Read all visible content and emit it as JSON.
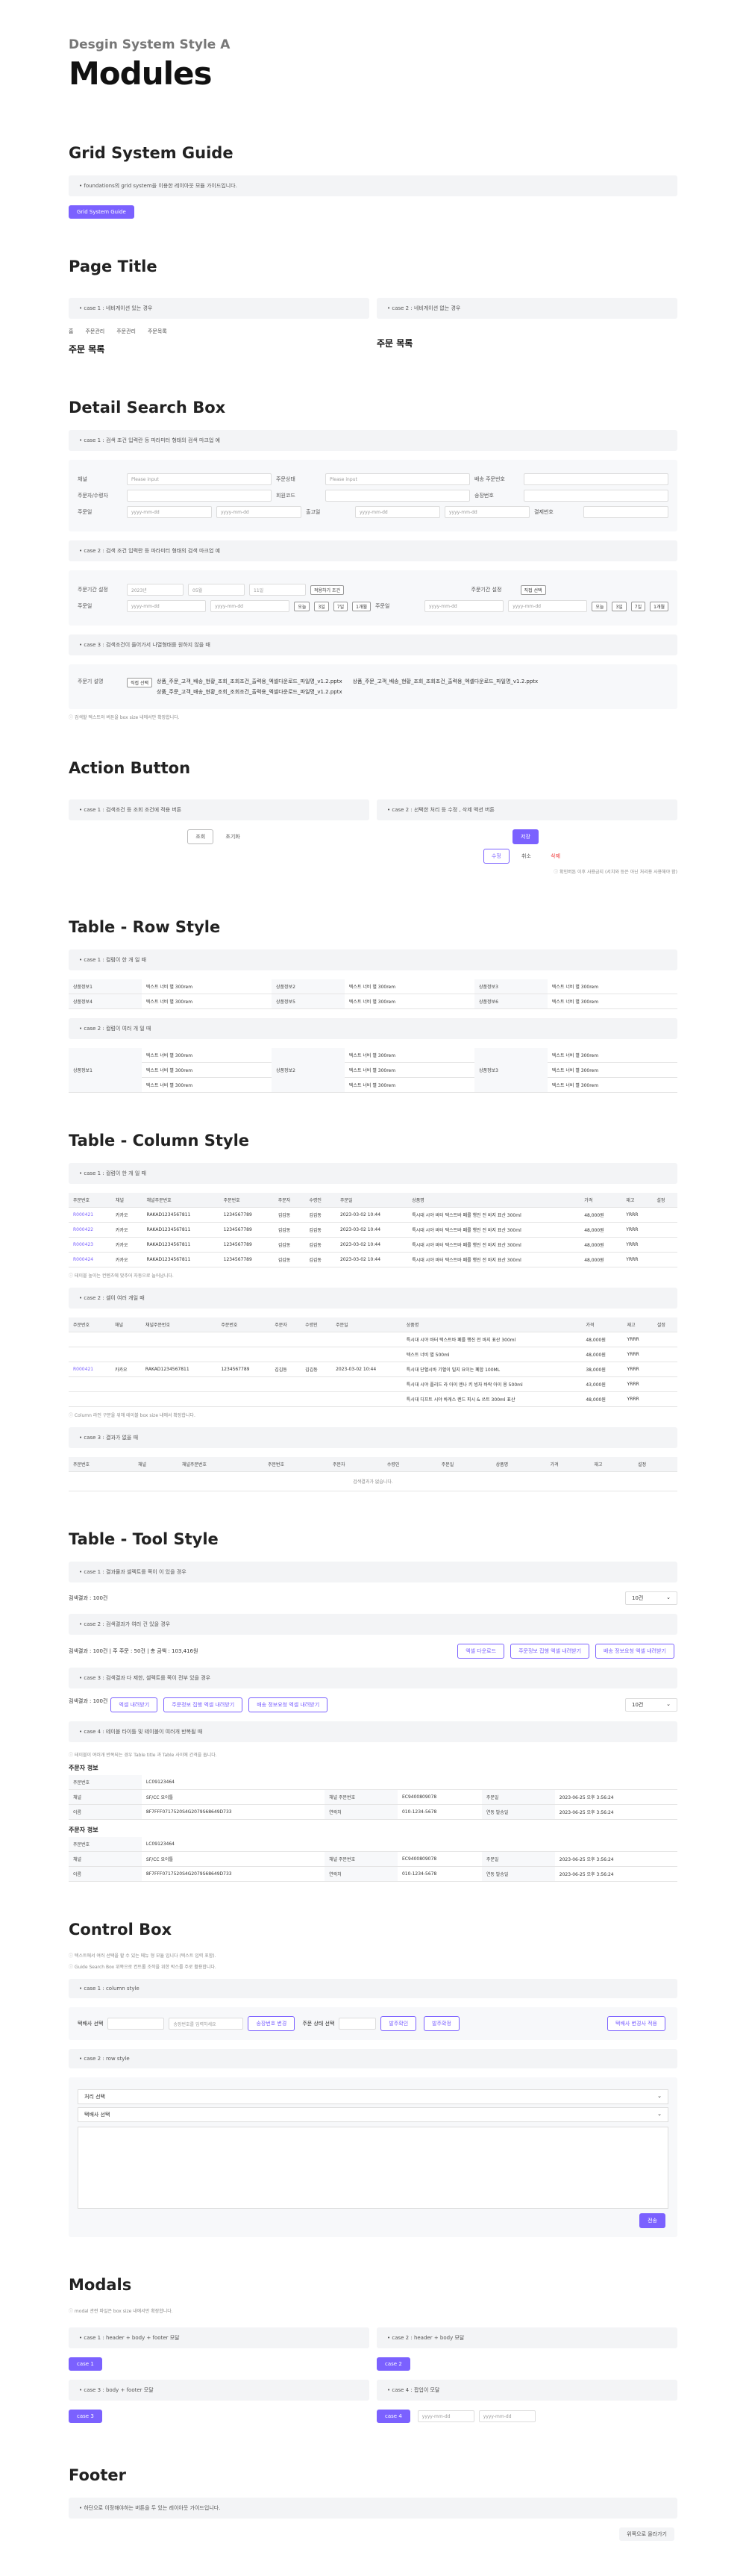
{
  "header": {
    "sub": "Desgin System Style A",
    "title": "Modules"
  },
  "grid": {
    "title": "Grid System Guide",
    "case": "foundations의 grid system을 이용한 레이아웃 모듈 가이드입니다.",
    "button": "Grid System Guide"
  },
  "page_title": {
    "title": "Page Title",
    "case1": "case 1 : 네비게이션 있는 경우",
    "case2": "case 2 : 네비게이션 없는 경우",
    "crumbs": [
      "홈",
      "주문관리",
      "주문관리",
      "주문목록"
    ],
    "heading": "주문 목록"
  },
  "detail": {
    "title": "Detail Search Box",
    "case1": "case 1 : 검색 조건 입력란 등 파라미터 형태의 검색 마크업 예",
    "labels1": [
      "채널",
      "주문상태",
      "배송 주문번호",
      "주문자/수령자",
      "회원코드",
      "송장번호",
      "주문일",
      "출고일",
      "결제번호"
    ],
    "please": "Please input",
    "date_ph": "yyyy-mm-dd",
    "case2": "case 2 : 검색 조건 입력란 등 파라미터 형태의 검색 마크업 예",
    "labels2": [
      "주문기간 설정",
      "주문일",
      "주문기간 설정",
      "주문일"
    ],
    "year": "2023년",
    "month": "05월",
    "day": "11일",
    "btn_set": "적용하기 조건",
    "quick": [
      "오늘",
      "3일",
      "7일",
      "1개월"
    ],
    "chk": "직접 선택",
    "case3": "case 3 : 검색조건이 들어가서 나열형태를 원하지 않을 때",
    "label3": "주문기 설명",
    "chk3": "직접 선택",
    "files": [
      "상품_주문_고객_배송_현황_조회_조회조건_출력용_엑셀다운로드_파일명_v1.2.pptx",
      "상품_주문_고객_배송_현황_조회_조회조건_출력용_엑셀다운로드_파일명_v1.2.pptx",
      "상품_주문_고객_배송_현황_조회_조회조건_출력용_엑셀다운로드_파일명_v1.2.pptx"
    ],
    "note": "검색할 텍스트와 버튼을 box size 내에서만 확장합니다."
  },
  "action": {
    "title": "Action Button",
    "case1": "case 1 : 검색조건 등 조회 조건에 적용 버튼",
    "case2": "case 2 : 선택한 처리 등 수정 , 삭제 액션 버튼",
    "search": "조회",
    "reset": "초기화",
    "save": "저장",
    "cancel": "취소",
    "delete": "삭제",
    "btn_a": "수정",
    "btn_b": "취소",
    "note": "확인버튼 이후 사용금지 (서치와 등은 아닌 처리용 사용해야 함)"
  },
  "row_table": {
    "title": "Table - Row Style",
    "case1": "case 1 : 컬럼이 한 개 일 때",
    "case2": "case 2 : 컬럼이 여러 개 일 때",
    "lbls": [
      "상품정보1",
      "상품정보2",
      "상품정보3"
    ],
    "lbls2": [
      "상품정보4",
      "상품정보5",
      "상품정보6"
    ],
    "val": "텍스트 너비 별 300rem"
  },
  "col_table": {
    "title": "Table - Column Style",
    "case1": "case 1 : 컬럼이 한 개 일 때",
    "headers": [
      "주문번호",
      "채널",
      "채널주문번호",
      "주문번호",
      "주문자",
      "수령인",
      "주문일",
      "상품명",
      "가격",
      "재고",
      "설정"
    ],
    "rows": [
      [
        "R000421",
        "카카오",
        "RAKAD1234567811",
        "1234567789",
        "김김동",
        "김김동",
        "2023-03-02 10:44",
        "특시대 시야 바터 텍스트바 폐를 행진 전 바지 표산 300ml",
        "48,000원",
        "YRRR"
      ],
      [
        "R000422",
        "카카오",
        "RAKAD1234567811",
        "1234567789",
        "김김동",
        "김김동",
        "2023-03-02 10:44",
        "특시대 시야 바터 텍스트바 폐를 행진 전 바지 표산 300ml",
        "48,000원",
        "YRRR"
      ],
      [
        "R000423",
        "카카오",
        "RAKAD1234567811",
        "1234567789",
        "김김동",
        "김김동",
        "2023-03-02 10:44",
        "특시대 시야 바터 텍스트바 폐를 행진 전 바지 표산 300ml",
        "48,000원",
        "YRRR"
      ],
      [
        "R000424",
        "카카오",
        "RAKAD1234567811",
        "1234567789",
        "김김동",
        "김김동",
        "2023-03-02 10:44",
        "특시대 시야 바터 텍스트바 폐를 행진 전 바지 표산 300ml",
        "48,000원",
        "YRRR"
      ]
    ],
    "note1": "테이블 높이는 컨텐츠에 맞추어 자동으로 늘어납니다.",
    "case2": "case 2 : 셀이 여러 개일 때",
    "row2": [
      "R000421",
      "카카오",
      "RAKAD1234567811",
      "1234567789",
      "김김동",
      "김김동",
      "2023-03-02 10:44"
    ],
    "items2": [
      [
        "특시대 시야 바터 텍스트바 폐를 행진 전 바지 표산 300ml",
        "48,000원",
        "YRRR"
      ],
      [
        "텍스트 너비 별 500ml",
        "48,000원",
        "YRRR"
      ],
      [
        "특시대 단혈시바 기혈이 밀지 요이는 폐합 100ML",
        "38,000원",
        "YRRR"
      ],
      [
        "특시대 시야 플리드 라 아이 엔나 키 빙자 바락 아이 용 500ml",
        "43,000원",
        "YRRR"
      ],
      [
        "특시대 디프트 시야 바캐스 렌드 피시 & 쓰트 300ml 표산",
        "48,000원",
        "YRRR"
      ]
    ],
    "note2": "Column 라인 구분을 위해 테이블 box size 내에서 확장합니다.",
    "case3": "case 3 : 결과가 없을 때",
    "empty": "검색결과가 없습니다."
  },
  "tool": {
    "title": "Table - Tool Style",
    "case1": "case 1 : 결과물과 셀렉트를 쪽이 이 있을 경우",
    "count": "검색결과 : 100건",
    "select": "10건",
    "case2": "case 2 : 검색결과가 여러 건 있을 경우",
    "counts": "검색결과 : 100건  |  주 주문 : 50건  |  총 금액 : 103,416원",
    "btns": [
      "엑셀 다운로드",
      "주문정보 집행 엑셀 내려받기",
      "배송 정보요청 엑셀 내려받기"
    ],
    "case3": "case 3 : 검색결과 다 제한, 셀렉트를 쪽이 전부 있을 경우",
    "btns3": [
      "엑셀 내려받기",
      "주문정보 집행 엑셀 내려받기",
      "배송 정보요청 엑셀 내려받기"
    ],
    "case4": "case 4 : 테이블 타이틀 및 테이블이 여러개 반복될 때",
    "note4": "테이블이 여러개 반복되는 경우 Table title 과 Table 사이에 간격을 둡니다.",
    "info_title": "주문자 정보",
    "info": [
      [
        "주문번호",
        "LC09123464",
        ""
      ],
      [
        "채널명",
        "쿠팡",
        ""
      ]
    ],
    "infoRow": [
      "채널",
      "SF/CC 요이틀",
      "채널 주문번호",
      "EC9400809078",
      "주문일",
      "2023-06-25 오후 3:56:24"
    ],
    "infoRow2": [
      "이름",
      "8F7FFF0717520S4G2079S68649D733",
      "연락처",
      "010-1234-5678",
      "연동 발송일",
      "2023-06-25 오후 3:56:24"
    ]
  },
  "control": {
    "title": "Control Box",
    "note1": "텍스트에서 여러 선택을 할 수 있는 메뉴 형 모듈 입니다 (텍스트 입력 포함).",
    "note2": "Guide Search Box 위쪽으로 컨트롤 조작을 위한 박스를 주로 활용합니다.",
    "case1": "case 1 : column style",
    "label1": "택배사 선택",
    "ph1": "송장번호를 입력하세요",
    "btn1": "송장번호 변경",
    "label2": "주문 상태 선택",
    "btn2": "발주확인",
    "btn3": "발주확정",
    "right": "택배사 변경사 적용",
    "case2": "case 2 : row style",
    "sel1": "처리 선택",
    "sel2": "택배사 선택",
    "send": "전송"
  },
  "modals": {
    "title": "Modals",
    "note": "modal 관련 파일은 box size 내에서만 확장합니다.",
    "c1": "case 1 : header + body + footer 모달",
    "c2": "case 2 : header + body 모달",
    "c3": "case 3 : body + footer 모달",
    "c4": "case 4 : 팝업이 모달",
    "b1": "case 1",
    "b2": "case 2",
    "b3": "case 3",
    "b4": "case 4",
    "date_ph": "yyyy-mm-dd"
  },
  "footer": {
    "title": "Footer",
    "case": "하단으로 이정해야하는 버튼을 두 있는 레이아웃 가이드입니다.",
    "top": "위쪽으로 올라가기"
  }
}
